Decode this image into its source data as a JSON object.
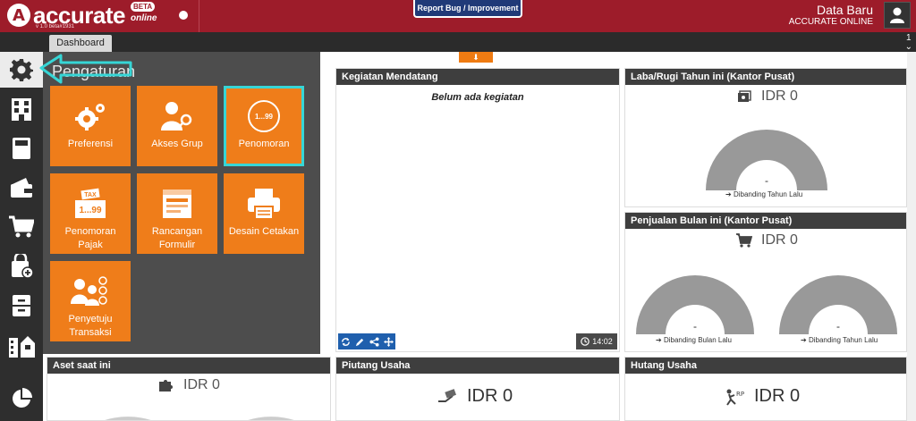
{
  "app": {
    "logo_letter": "A",
    "logo_text": "accurate",
    "beta": "BETA",
    "online": "online",
    "version": "v 1.0 beta#1931",
    "report_bug": "Report Bug / Improvement",
    "company_name": "Data Baru",
    "company_sub": "ACCURATE ONLINE",
    "brand_color": "#9d1c2a"
  },
  "tabs": {
    "dashboard": "Dashboard",
    "count": "1"
  },
  "sidebar": {
    "items": [
      "gear-icon",
      "building-icon",
      "book-icon",
      "wallet-icon",
      "cart-icon",
      "bag-plus-icon",
      "cabinet-icon",
      "city-icon",
      "pie-icon"
    ]
  },
  "settings": {
    "title": "Pengaturan",
    "tiles": [
      {
        "label": "Preferensi",
        "icon": "gears-icon"
      },
      {
        "label": "Akses Grup",
        "icon": "user-key-icon"
      },
      {
        "label": "Penomoran",
        "icon": "numbering-icon",
        "badge": "1...99"
      },
      {
        "label": "Penomoran Pajak",
        "icon": "tax-icon",
        "badge_top": "TAX",
        "badge": "1...99"
      },
      {
        "label": "Rancangan Formulir",
        "icon": "form-icon"
      },
      {
        "label": "Desain Cetakan",
        "icon": "printer-icon"
      },
      {
        "label": "Penyetuju Transaksi",
        "icon": "approver-icon"
      }
    ]
  },
  "panels": {
    "kegiatan": {
      "title": "Kegiatan Mendatang",
      "empty": "Belum ada kegiatan",
      "time": "14:02"
    },
    "labarugi": {
      "title": "Laba/Rugi Tahun ini (Kantor Pusat)",
      "value": "IDR 0",
      "dash": "-",
      "compare": "Dibanding Tahun Lalu"
    },
    "penjualan": {
      "title": "Penjualan Bulan ini (Kantor Pusat)",
      "value": "IDR 0",
      "dash1": "-",
      "compare1": "Dibanding Bulan Lalu",
      "dash2": "-",
      "compare2": "Dibanding Tahun Lalu"
    },
    "aset": {
      "title": "Aset saat ini",
      "value": "IDR 0"
    },
    "piutang": {
      "title": "Piutang Usaha",
      "value": "IDR 0"
    },
    "hutang": {
      "title": "Hutang Usaha",
      "value": "IDR 0"
    }
  }
}
